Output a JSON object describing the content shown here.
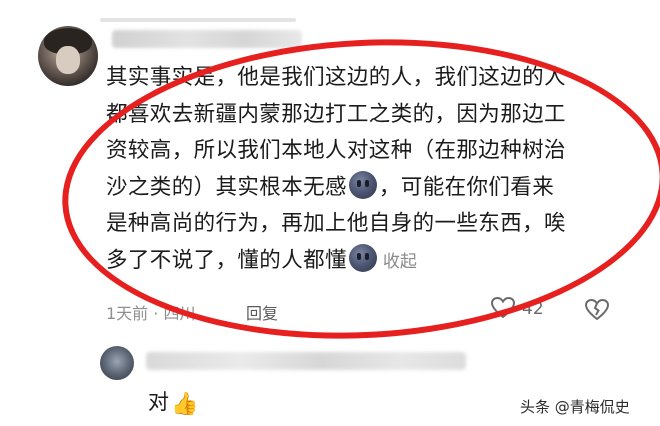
{
  "comment": {
    "lines": [
      "其实事实是，他是我们这边的人，我们这边的人",
      "都喜欢去新疆内蒙那边打工之类的，因为那边工",
      "资较高，所以我们本地人对这种（在那边种树治",
      "沙之类的）其实根本无感"
    ],
    "line4_rest": "，可能在你们看来",
    "line5": "是种高尚的行为，再加上他自身的一些东西，唉",
    "line6_pre": "多了不说了，懂的人都懂",
    "collapse_label": "收起",
    "emoji_name": "smiling-face-emoji"
  },
  "meta": {
    "time_location": "1天前 · 四川",
    "reply_label": "回复",
    "like_count": "42"
  },
  "reply": {
    "text": "对",
    "thumb": "👍"
  },
  "watermark": "头条 @青梅侃史",
  "colors": {
    "highlight_ring": "#e5201f",
    "text": "#1b1b1b",
    "meta": "#8f8f8f"
  }
}
